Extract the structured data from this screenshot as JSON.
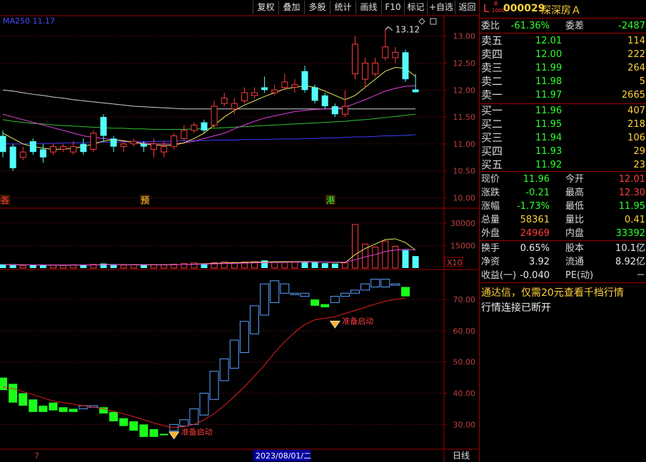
{
  "toolbar": {
    "buttons": [
      "复权",
      "叠加",
      "多股",
      "统计",
      "画线",
      "F10",
      "标记",
      "+自选",
      "返回"
    ]
  },
  "stock": {
    "market_letter": "L",
    "sub_r": "R",
    "sub_code": "1000",
    "code": "000029",
    "name": "深深房Ａ"
  },
  "order_book": {
    "ratio_label": "委比",
    "ratio_value": "-61.36%",
    "diff_label": "委差",
    "diff_value": "-2487",
    "sells": [
      {
        "label": "卖五",
        "price": "12.01",
        "vol": "114"
      },
      {
        "label": "卖四",
        "price": "12.00",
        "vol": "222"
      },
      {
        "label": "卖三",
        "price": "11.99",
        "vol": "264"
      },
      {
        "label": "卖二",
        "price": "11.98",
        "vol": "5"
      },
      {
        "label": "卖一",
        "price": "11.97",
        "vol": "2665"
      }
    ],
    "buys": [
      {
        "label": "买一",
        "price": "11.96",
        "vol": "407"
      },
      {
        "label": "买二",
        "price": "11.95",
        "vol": "218"
      },
      {
        "label": "买三",
        "price": "11.94",
        "vol": "106"
      },
      {
        "label": "买四",
        "price": "11.93",
        "vol": "29"
      },
      {
        "label": "买五",
        "price": "11.92",
        "vol": "23"
      }
    ]
  },
  "quote": {
    "rows": [
      {
        "l1": "现价",
        "v1": "11.96",
        "l2": "今开",
        "v2": "12.01"
      },
      {
        "l1": "涨跌",
        "v1": "-0.21",
        "l2": "最高",
        "v2": "12.30"
      },
      {
        "l1": "涨幅",
        "v1": "-1.73%",
        "l2": "最低",
        "v2": "11.95"
      },
      {
        "l1": "总量",
        "v1": "58361",
        "l2": "量比",
        "v2": "0.41"
      },
      {
        "l1": "外盘",
        "v1": "24969",
        "l2": "内盘",
        "v2": "33392"
      }
    ],
    "rows2": [
      {
        "l1": "换手",
        "v1": "0.65%",
        "l2": "股本",
        "v2": "10.1亿"
      },
      {
        "l1": "净资",
        "v1": "3.92",
        "l2": "流通",
        "v2": "8.92亿"
      },
      {
        "l1": "收益(一)",
        "v1": "-0.040",
        "l2": "PE(动)",
        "v2": "－"
      }
    ]
  },
  "messages": {
    "ad": "通达信，仅需20元查看千档行情",
    "status": "行情连接已断开"
  },
  "main_chart": {
    "ma_label": "MA250",
    "ma_value": "11.17",
    "peak_label": "13.12",
    "y_ticks": [
      "13.00",
      "12.50",
      "12.00",
      "11.50",
      "11.00",
      "10.50",
      "10.00"
    ],
    "markers": [
      "各",
      "预",
      "港"
    ]
  },
  "volume_chart": {
    "y_ticks": [
      "30000",
      "15000"
    ],
    "unit": "X10"
  },
  "indicator_chart": {
    "y_ticks": [
      "70.00",
      "60.00",
      "50.00",
      "40.00",
      "30.00"
    ],
    "signal_text": "准备启动"
  },
  "bottom_bar": {
    "left_label": "7",
    "date_label": "2023/08/01/二",
    "period": "日线"
  },
  "chart_data": [
    {
      "type": "candlestick",
      "title": "",
      "ylim": [
        9.9,
        13.3
      ],
      "y_ticks": [
        13.0,
        12.5,
        12.0,
        11.5,
        11.0,
        10.5,
        10.0
      ],
      "candles": [
        {
          "o": 11.15,
          "c": 10.85,
          "h": 11.25,
          "l": 10.75
        },
        {
          "o": 10.95,
          "c": 10.55,
          "h": 11.0,
          "l": 10.5
        },
        {
          "o": 10.75,
          "c": 10.85,
          "h": 10.95,
          "l": 10.7
        },
        {
          "o": 11.05,
          "c": 10.85,
          "h": 11.1,
          "l": 10.8
        },
        {
          "o": 10.9,
          "c": 10.75,
          "h": 11.0,
          "l": 10.65
        },
        {
          "o": 10.85,
          "c": 10.95,
          "h": 11.0,
          "l": 10.8
        },
        {
          "o": 10.9,
          "c": 10.95,
          "h": 11.0,
          "l": 10.85
        },
        {
          "o": 10.85,
          "c": 10.95,
          "h": 11.05,
          "l": 10.8
        },
        {
          "o": 11.0,
          "c": 10.85,
          "h": 11.1,
          "l": 10.8
        },
        {
          "o": 10.9,
          "c": 11.2,
          "h": 11.25,
          "l": 10.85
        },
        {
          "o": 11.5,
          "c": 11.15,
          "h": 11.55,
          "l": 11.05
        },
        {
          "o": 11.1,
          "c": 10.95,
          "h": 11.15,
          "l": 10.85
        },
        {
          "o": 10.95,
          "c": 11.0,
          "h": 11.05,
          "l": 10.85
        },
        {
          "o": 11.0,
          "c": 11.05,
          "h": 11.1,
          "l": 10.95
        },
        {
          "o": 11.0,
          "c": 10.95,
          "h": 11.05,
          "l": 10.85
        },
        {
          "o": 10.9,
          "c": 11.0,
          "h": 11.1,
          "l": 10.75
        },
        {
          "o": 10.85,
          "c": 10.95,
          "h": 11.05,
          "l": 10.75
        },
        {
          "o": 10.95,
          "c": 11.15,
          "h": 11.2,
          "l": 10.9
        },
        {
          "o": 11.1,
          "c": 11.25,
          "h": 11.35,
          "l": 11.05
        },
        {
          "o": 11.25,
          "c": 11.35,
          "h": 11.4,
          "l": 11.2
        },
        {
          "o": 11.4,
          "c": 11.25,
          "h": 11.45,
          "l": 11.2
        },
        {
          "o": 11.35,
          "c": 11.7,
          "h": 11.8,
          "l": 11.3
        },
        {
          "o": 11.75,
          "c": 11.85,
          "h": 11.95,
          "l": 11.7
        },
        {
          "o": 11.65,
          "c": 11.75,
          "h": 11.85,
          "l": 11.55
        },
        {
          "o": 11.8,
          "c": 11.95,
          "h": 12.05,
          "l": 11.75
        },
        {
          "o": 11.9,
          "c": 11.95,
          "h": 12.05,
          "l": 11.85
        },
        {
          "o": 12.05,
          "c": 12.0,
          "h": 12.25,
          "l": 11.95
        },
        {
          "o": 11.95,
          "c": 12.0,
          "h": 12.1,
          "l": 11.9
        },
        {
          "o": 12.05,
          "c": 12.15,
          "h": 12.3,
          "l": 12.0
        },
        {
          "o": 12.05,
          "c": 12.1,
          "h": 12.2,
          "l": 11.95
        },
        {
          "o": 12.35,
          "c": 12.0,
          "h": 12.45,
          "l": 11.95
        },
        {
          "o": 12.05,
          "c": 11.8,
          "h": 12.1,
          "l": 11.75
        },
        {
          "o": 11.9,
          "c": 11.7,
          "h": 11.95,
          "l": 11.65
        },
        {
          "o": 11.7,
          "c": 11.55,
          "h": 11.75,
          "l": 11.5
        },
        {
          "o": 11.55,
          "c": 11.7,
          "h": 12.0,
          "l": 11.5
        },
        {
          "o": 12.3,
          "c": 12.85,
          "h": 13.0,
          "l": 12.2
        },
        {
          "o": 12.2,
          "c": 12.5,
          "h": 12.6,
          "l": 12.05
        },
        {
          "o": 12.3,
          "c": 12.5,
          "h": 12.6,
          "l": 12.25
        },
        {
          "o": 12.6,
          "c": 12.8,
          "h": 13.12,
          "l": 12.55
        },
        {
          "o": 12.6,
          "c": 12.7,
          "h": 12.8,
          "l": 12.5
        },
        {
          "o": 12.7,
          "c": 12.2,
          "h": 12.75,
          "l": 12.15
        },
        {
          "o": 12.01,
          "c": 11.96,
          "h": 12.3,
          "l": 11.95
        }
      ],
      "ma_lines": [
        {
          "name": "MA250",
          "color": "#3a3aff",
          "values": [
            11.0,
            11.0,
            11.0,
            11.01,
            11.01,
            11.01,
            11.02,
            11.02,
            11.02,
            11.03,
            11.03,
            11.03,
            11.04,
            11.04,
            11.04,
            11.05,
            11.05,
            11.05,
            11.06,
            11.06,
            11.06,
            11.07,
            11.07,
            11.07,
            11.08,
            11.08,
            11.08,
            11.09,
            11.09,
            11.09,
            11.1,
            11.1,
            11.11,
            11.11,
            11.12,
            11.13,
            11.13,
            11.14,
            11.15,
            11.15,
            11.16,
            11.17
          ]
        },
        {
          "name": "",
          "color": "#30c030",
          "values": [
            11.45,
            11.42,
            11.4,
            11.38,
            11.37,
            11.35,
            11.34,
            11.33,
            11.32,
            11.31,
            11.3,
            11.29,
            11.29,
            11.28,
            11.28,
            11.27,
            11.27,
            11.27,
            11.27,
            11.28,
            11.28,
            11.29,
            11.3,
            11.31,
            11.32,
            11.33,
            11.34,
            11.35,
            11.36,
            11.37,
            11.38,
            11.39,
            11.4,
            11.41,
            11.42,
            11.44,
            11.45,
            11.47,
            11.49,
            11.51,
            11.53,
            11.55
          ]
        },
        {
          "name": "",
          "color": "#d0d0d0",
          "values": [
            12.0,
            11.98,
            11.95,
            11.92,
            11.9,
            11.87,
            11.85,
            11.82,
            11.8,
            11.78,
            11.76,
            11.74,
            11.72,
            11.7,
            11.69,
            11.68,
            11.67,
            11.66,
            11.65,
            11.65,
            11.65,
            11.65,
            11.65,
            11.65,
            11.65,
            11.65,
            11.65,
            11.65,
            11.65,
            11.65,
            11.65,
            11.65,
            11.65,
            11.65,
            11.65,
            11.65,
            11.65,
            11.65,
            11.65,
            11.65,
            11.65,
            11.65
          ]
        },
        {
          "name": "",
          "color": "#e040e0",
          "values": [
            11.55,
            11.5,
            11.45,
            11.4,
            11.35,
            11.3,
            11.25,
            11.2,
            11.15,
            11.12,
            11.1,
            11.08,
            11.05,
            11.03,
            11.02,
            11.0,
            11.0,
            11.0,
            11.02,
            11.05,
            11.1,
            11.15,
            11.2,
            11.28,
            11.35,
            11.42,
            11.48,
            11.52,
            11.56,
            11.6,
            11.62,
            11.64,
            11.65,
            11.66,
            11.68,
            11.75,
            11.82,
            11.9,
            11.98,
            12.03,
            12.07,
            12.08
          ]
        },
        {
          "name": "",
          "color": "#e8e860",
          "values": [
            11.2,
            11.1,
            11.0,
            10.95,
            10.92,
            10.9,
            10.9,
            10.92,
            10.95,
            11.0,
            11.05,
            11.08,
            11.06,
            11.03,
            11.0,
            10.98,
            10.97,
            10.98,
            11.02,
            11.1,
            11.2,
            11.35,
            11.5,
            11.62,
            11.72,
            11.8,
            11.88,
            11.95,
            12.02,
            12.05,
            12.08,
            12.05,
            11.98,
            11.9,
            11.82,
            11.9,
            12.05,
            12.2,
            12.35,
            12.42,
            12.4,
            12.25
          ]
        }
      ]
    },
    {
      "type": "bar",
      "title": "",
      "ylim": [
        0,
        38000
      ],
      "y_ticks": [
        30000,
        15000
      ],
      "values": [
        2500,
        2000,
        1800,
        2100,
        1900,
        2000,
        1800,
        2200,
        2000,
        2500,
        3000,
        2100,
        2000,
        2200,
        2000,
        2300,
        2100,
        2600,
        3000,
        3400,
        3100,
        3600,
        4200,
        3800,
        4000,
        4300,
        5100,
        4300,
        4100,
        4200,
        4500,
        3800,
        3300,
        3000,
        3500,
        29000,
        16000,
        14000,
        18000,
        14500,
        12000,
        8000
      ],
      "ma_lines": [
        {
          "name": "",
          "color": "#e8e860",
          "values": [
            2400,
            2300,
            2200,
            2100,
            2050,
            2000,
            1950,
            2000,
            2050,
            2100,
            2300,
            2350,
            2300,
            2200,
            2150,
            2200,
            2200,
            2250,
            2400,
            2600,
            2900,
            3100,
            3400,
            3600,
            3800,
            3900,
            4100,
            4200,
            4250,
            4300,
            4350,
            4200,
            4000,
            3800,
            3600,
            9000,
            13000,
            16000,
            19000,
            19500,
            17000,
            12000
          ]
        },
        {
          "name": "",
          "color": "#e040e0",
          "values": [
            2300,
            2250,
            2200,
            2150,
            2100,
            2050,
            2050,
            2050,
            2100,
            2150,
            2200,
            2250,
            2300,
            2300,
            2300,
            2300,
            2300,
            2350,
            2400,
            2500,
            2650,
            2800,
            3000,
            3150,
            3300,
            3450,
            3600,
            3700,
            3800,
            3900,
            4000,
            4050,
            4050,
            4000,
            3950,
            5500,
            7500,
            9000,
            11000,
            12000,
            12500,
            12000
          ]
        }
      ]
    },
    {
      "type": "bar",
      "title": "",
      "ylim": [
        23,
        78
      ],
      "y_ticks": [
        70,
        60,
        50,
        40,
        30
      ],
      "bars": [
        {
          "o": 45.0,
          "c": 41.0,
          "color": "green"
        },
        {
          "o": 43.0,
          "c": 37.0,
          "color": "green"
        },
        {
          "o": 40.0,
          "c": 36.0,
          "color": "green"
        },
        {
          "o": 38.0,
          "c": 34.0,
          "color": "green"
        },
        {
          "o": 36.0,
          "c": 34.0,
          "color": "green"
        },
        {
          "o": 37.0,
          "c": 34.5,
          "color": "green"
        },
        {
          "o": 35.5,
          "c": 34.0,
          "color": "green"
        },
        {
          "o": 35.0,
          "c": 34.0,
          "color": "green"
        },
        {
          "o": 35.0,
          "c": 36.0,
          "color": "blue"
        },
        {
          "o": 35.5,
          "c": 36.0,
          "color": "blue"
        },
        {
          "o": 35.5,
          "c": 33.5,
          "color": "green"
        },
        {
          "o": 34.0,
          "c": 31.0,
          "color": "green"
        },
        {
          "o": 32.0,
          "c": 29.5,
          "color": "green"
        },
        {
          "o": 31.0,
          "c": 28.0,
          "color": "green"
        },
        {
          "o": 30.0,
          "c": 26.0,
          "color": "green"
        },
        {
          "o": 28.5,
          "c": 26.0,
          "color": "green"
        },
        {
          "o": 27.0,
          "c": 27.0,
          "color": "green"
        },
        {
          "o": 28.0,
          "c": 30.0,
          "color": "blue"
        },
        {
          "o": 29.5,
          "c": 31.5,
          "color": "blue"
        },
        {
          "o": 30.0,
          "c": 35.0,
          "color": "blue"
        },
        {
          "o": 33.0,
          "c": 40.0,
          "color": "blue"
        },
        {
          "o": 38.0,
          "c": 47.0,
          "color": "blue"
        },
        {
          "o": 44.0,
          "c": 51.0,
          "color": "blue"
        },
        {
          "o": 48.0,
          "c": 57.0,
          "color": "blue"
        },
        {
          "o": 53.0,
          "c": 63.0,
          "color": "blue"
        },
        {
          "o": 59.0,
          "c": 68.0,
          "color": "blue"
        },
        {
          "o": 65.0,
          "c": 75.0,
          "color": "blue"
        },
        {
          "o": 69.0,
          "c": 76.0,
          "color": "blue"
        },
        {
          "o": 72.0,
          "c": 75.0,
          "color": "blue"
        },
        {
          "o": 72.0,
          "c": 72.0,
          "color": "blue"
        },
        {
          "o": 71.0,
          "c": 72.0,
          "color": "blue"
        },
        {
          "o": 70.0,
          "c": 68.0,
          "color": "green"
        },
        {
          "o": 68.5,
          "c": 67.5,
          "color": "green"
        },
        {
          "o": 69.0,
          "c": 71.0,
          "color": "blue"
        },
        {
          "o": 71.0,
          "c": 72.0,
          "color": "blue"
        },
        {
          "o": 72.0,
          "c": 73.0,
          "color": "blue"
        },
        {
          "o": 73.0,
          "c": 75.0,
          "color": "blue"
        },
        {
          "o": 74.0,
          "c": 76.5,
          "color": "blue"
        },
        {
          "o": 74.0,
          "c": 76.5,
          "color": "blue"
        },
        {
          "o": 75.0,
          "c": 75.0,
          "color": "blue"
        },
        {
          "o": 74.0,
          "c": 71.0,
          "color": "green"
        }
      ],
      "signal_line": [
        42.0,
        41.5,
        40.5,
        39.5,
        38.5,
        37.5,
        37.0,
        36.5,
        36.0,
        35.5,
        35.0,
        34.2,
        33.4,
        32.5,
        31.5,
        30.5,
        29.6,
        29.0,
        29.3,
        30.0,
        31.5,
        33.5,
        36.0,
        39.0,
        42.0,
        45.5,
        49.0,
        53.0,
        56.5,
        59.5,
        62.0,
        63.5,
        64.0,
        64.5,
        65.5,
        66.5,
        67.5,
        68.5,
        69.5,
        70.0,
        70.5
      ],
      "signal_points": [
        17,
        33
      ]
    }
  ]
}
